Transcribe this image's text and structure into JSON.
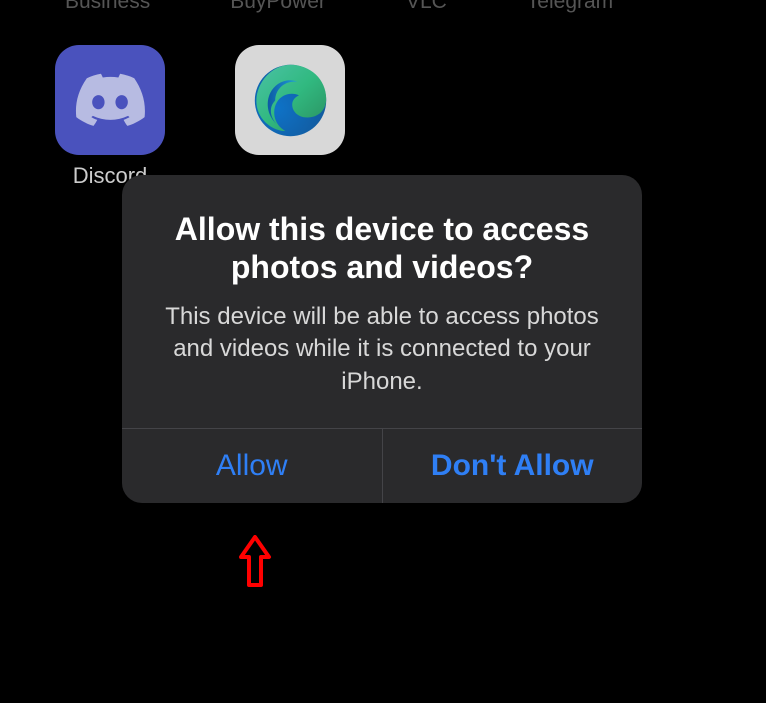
{
  "home": {
    "top_labels": [
      "Business",
      "BuyPower",
      "VLC",
      "Telegram"
    ],
    "apps": [
      {
        "name": "Discord",
        "label": "Discord"
      },
      {
        "name": "Edge",
        "label": ""
      }
    ]
  },
  "dialog": {
    "title": "Allow this device to access photos and videos?",
    "message": "This device will be able to access photos and videos while it is connected to your iPhone.",
    "allow_label": "Allow",
    "dont_allow_label": "Don't Allow"
  },
  "colors": {
    "accent": "#2f7ff5",
    "discord": "#4a52bd",
    "dialog_bg": "#2a2a2c"
  }
}
